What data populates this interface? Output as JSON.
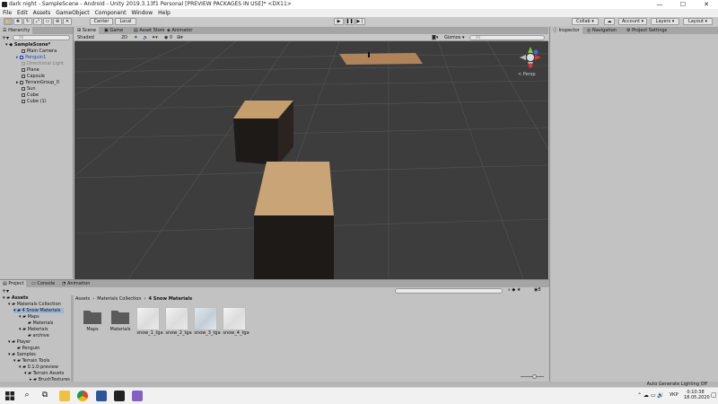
{
  "window": {
    "title": "dark night - SampleScene - Android - Unity 2019.3.13f1 Personal [PREVIEW PACKAGES IN USE]* <DX11>",
    "controls": [
      "—",
      "☐",
      "✕"
    ]
  },
  "menu": [
    "File",
    "Edit",
    "Assets",
    "GameObject",
    "Component",
    "Window",
    "Help"
  ],
  "toolbar": {
    "pivot": "Center",
    "space": "Local",
    "collab": "Collab ▾",
    "account": "Account ▾",
    "layers": "Layers ▾",
    "layout": "Layout ▾"
  },
  "hierarchy": {
    "tab": "Hierarchy",
    "search_placeholder": "All",
    "scene": "SampleScene*",
    "items": [
      {
        "label": "Main Camera",
        "state": "normal"
      },
      {
        "label": "Penguin1",
        "state": "selected"
      },
      {
        "label": "Directional Light",
        "state": "dim"
      },
      {
        "label": "Plane",
        "state": "normal"
      },
      {
        "label": "Capsule",
        "state": "normal"
      },
      {
        "label": "TerrainGroup_0",
        "state": "normal"
      },
      {
        "label": "Sun",
        "state": "normal"
      },
      {
        "label": "Cube",
        "state": "normal"
      },
      {
        "label": "Cube (1)",
        "state": "normal"
      }
    ]
  },
  "scene_tabs": [
    "Scene",
    "Game",
    "Asset Store",
    "Animator"
  ],
  "scene_toolbar": {
    "shading": "Shaded",
    "mode": "2D",
    "gizmos": "Gizmos ▾",
    "search_placeholder": "All"
  },
  "scene": {
    "gizmo_label": "< Persp"
  },
  "inspector_tabs": [
    "Inspector",
    "Navigation",
    "Project Settings"
  ],
  "bottom_tabs": [
    "Project",
    "Console",
    "Animation"
  ],
  "project": {
    "tree": [
      {
        "label": "Assets",
        "bold": true
      },
      {
        "label": "Materials Collection"
      },
      {
        "label": "4 Snow Materials",
        "selected": true
      },
      {
        "label": "Maps"
      },
      {
        "label": "Materials"
      },
      {
        "label": "Materials"
      },
      {
        "label": "archive"
      },
      {
        "label": "Player"
      },
      {
        "label": "Penguin"
      },
      {
        "label": "Samples"
      },
      {
        "label": "Terrain Tools"
      },
      {
        "label": "0.1.0-preview"
      },
      {
        "label": "Terrain Assets"
      },
      {
        "label": "BrushTextures"
      }
    ],
    "breadcrumb": [
      "Assets",
      "Materials Collection",
      "4 Snow Materials"
    ],
    "assets": [
      {
        "label": "Maps",
        "kind": "folder"
      },
      {
        "label": "Materials",
        "kind": "folder"
      },
      {
        "label": "snow_1_tga",
        "kind": "texture"
      },
      {
        "label": "snow_2_tga",
        "kind": "texture"
      },
      {
        "label": "snow_3_tga",
        "kind": "texture"
      },
      {
        "label": "snow_4_tga",
        "kind": "texture"
      }
    ],
    "hidden_count": "8"
  },
  "status": {
    "right": "Auto Generate Lighting Off"
  },
  "taskbar": {
    "lang": "УКР",
    "time": "0:10:38",
    "date": "18.05.2020",
    "icons": [
      "windows-start-icon",
      "search-icon",
      "task-view-icon",
      "file-explorer-icon",
      "chrome-icon",
      "word-icon",
      "unity-icon",
      "visual-studio-icon"
    ]
  },
  "colors": {
    "scene_bg": "#3d3d3d",
    "selection_blue": "#1849b5",
    "panel": "#c2c2c2",
    "cube_top": "#b08d5f",
    "cube_side": "#1e1a17"
  }
}
